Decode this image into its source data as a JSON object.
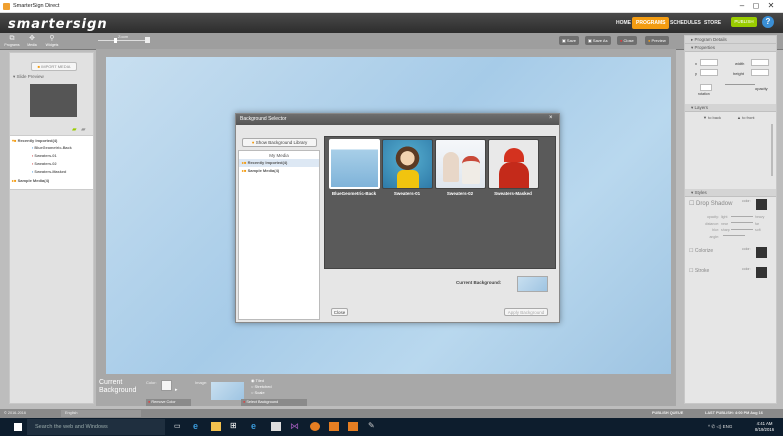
{
  "window": {
    "title": "SmarterSign Direct"
  },
  "header": {
    "logo": "smartersign",
    "nav": [
      "HOME",
      "PROGRAMS",
      "SCHEDULES",
      "STORE"
    ],
    "publish": "PUBLISH",
    "help": "?"
  },
  "toolbar": {
    "buttons": [
      "Programs",
      "Media",
      "Widgets"
    ],
    "zoom_label": "Zoom",
    "right_buttons": [
      "Save",
      "Save As",
      "Close",
      "Preview"
    ]
  },
  "left_panel": {
    "import_button": "IMPORT MEDIA",
    "slide_preview": "Slide Preview",
    "tree": [
      {
        "label": "Recently Imported(4)",
        "children": [
          "BlueGeometric-Back",
          "Sweaters-01",
          "Sweaters-02",
          "Sweaters-Masked"
        ]
      },
      {
        "label": "Sample Media(4)",
        "children": []
      }
    ]
  },
  "right_panel": {
    "program_details": "Program Details",
    "properties": "Properties",
    "x": "x",
    "y": "y",
    "width": "width",
    "height": "height",
    "rotation": "rotation",
    "opacity": "opacity",
    "layers": "Layers",
    "to_back": "to back",
    "to_front": "to front",
    "styles": "Styles",
    "drop_shadow": "Drop Shadow",
    "color": "color:",
    "opacity_row": "opacity:",
    "light": "light",
    "heavy": "heavy",
    "distance": "distance:",
    "near": "near",
    "far": "far",
    "blur": "blur:",
    "sharp": "sharp",
    "soft": "soft",
    "angle": "angle:",
    "colorize": "Colorize",
    "stroke": "Stroke"
  },
  "dialog": {
    "title": "Background Selector",
    "show_library": "Show Background Library",
    "my_media": "My Media",
    "tree": [
      "Recently Imported(4)",
      "Sample Media(4)"
    ],
    "tiles": [
      "BlueGeometric-Back",
      "Sweaters-01",
      "Sweaters-02",
      "Sweaters-Masked"
    ],
    "current_bg": "Current Background:",
    "close": "Close",
    "apply": "Apply Background"
  },
  "bottom_panel": {
    "current_bg_line1": "Current",
    "current_bg_line2": "Background",
    "color_label": "Color:",
    "image_label": "Image:",
    "remove_color": "Remove Color",
    "select_bg": "Select Background",
    "options": [
      "Tiled",
      "Stretched",
      "Scale"
    ]
  },
  "status": {
    "copyright": "© 2016-2016",
    "language": "English",
    "publish_queue": "PUBLISH QUEUE",
    "last_publish": "LAST PUBLISH: 4:00 PM Aug 16"
  },
  "taskbar": {
    "search": "Search the web and Windows",
    "tray": "^  ✆  ◁)  ENG",
    "time": "4:41 AM",
    "date": "8/19/2016"
  },
  "colors": {
    "accent": "#f39c12",
    "publish": "#99cc00",
    "dialog_bg": "#e6e6e6",
    "gallery_bg": "#5a5a5a"
  }
}
